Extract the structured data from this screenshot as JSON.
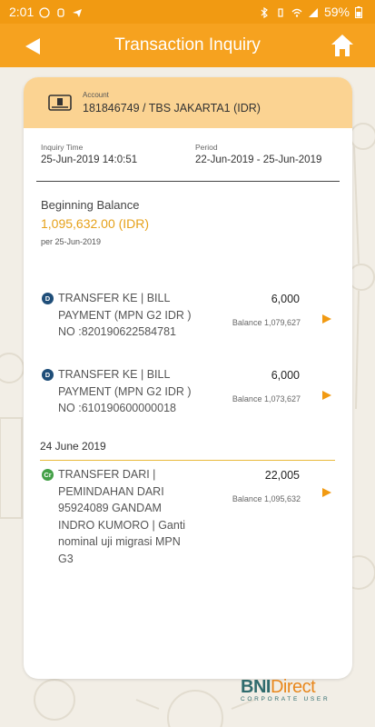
{
  "status_bar": {
    "time": "2:01",
    "battery": "59%"
  },
  "app_bar": {
    "title": "Transaction Inquiry",
    "back_icon": "back-arrow-icon",
    "home_icon": "home-icon"
  },
  "account": {
    "label": "Account",
    "value": "181846749 / TBS JAKARTA1 (IDR)"
  },
  "inquiry": {
    "time_label": "Inquiry Time",
    "time_value": "25-Jun-2019 14:0:51",
    "period_label": "Period",
    "period_value": "22-Jun-2019 - 25-Jun-2019"
  },
  "beginning_balance": {
    "label": "Beginning Balance",
    "amount": "1,095,632.00 (IDR)",
    "per": "per 25-Jun-2019"
  },
  "transactions": [
    {
      "type": "D",
      "description": "TRANSFER KE | BILL PAYMENT (MPN G2 IDR ) NO :820190622584781",
      "amount": "6,000",
      "balance": "Balance 1,079,627"
    },
    {
      "type": "D",
      "description": "TRANSFER KE | BILL PAYMENT (MPN G2 IDR ) NO :610190600000018",
      "amount": "6,000",
      "balance": "Balance 1,073,627"
    },
    {
      "type": "Cr",
      "description": "TRANSFER DARI | PEMINDAHAN DARI 95924089 GANDAM INDRO KUMORO | Ganti nominal uji migrasi MPN G3",
      "amount": "22,005",
      "balance": "Balance 1,095,632"
    }
  ],
  "date_separator": "24 June 2019",
  "brand": {
    "bni": "BNI",
    "direct": "Direct",
    "sub": "CORPORATE USER"
  },
  "colors": {
    "accent": "#f6a21f",
    "debit_badge": "#1f4e79",
    "credit_badge": "#43a047",
    "amount_highlight": "#e6a11a"
  }
}
